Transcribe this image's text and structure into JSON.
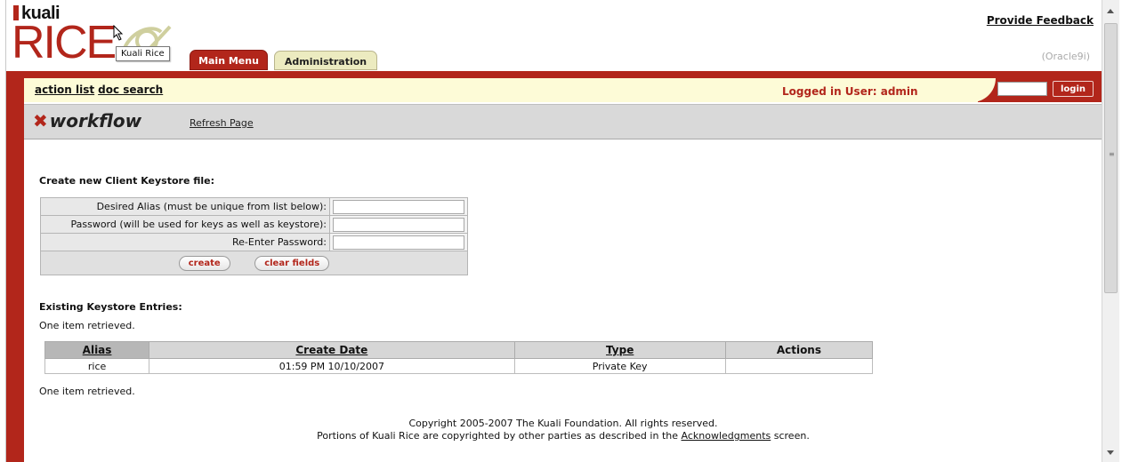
{
  "header": {
    "kuali_logo": "kuali",
    "rice_logo": "RICE",
    "tooltip": "Kuali Rice",
    "tabs": [
      {
        "label": "Main Menu",
        "active": true
      },
      {
        "label": "Administration",
        "active": false
      }
    ],
    "feedback_link": "Provide Feedback",
    "db_label": "(Oracle9i)"
  },
  "nav": {
    "action_list": "action list",
    "doc_search": "doc search",
    "logged_in": "Logged in User: admin",
    "login_button": "login"
  },
  "workflow": {
    "logo": "workflow",
    "refresh": "Refresh Page"
  },
  "create_form": {
    "heading": "Create new Client Keystore file:",
    "fields": [
      {
        "label": "Desired Alias (must be unique from list below):",
        "value": ""
      },
      {
        "label": "Password (will be used for keys as well as keystore):",
        "value": ""
      },
      {
        "label": "Re-Enter Password:",
        "value": ""
      }
    ],
    "create_button": "create",
    "clear_button": "clear fields"
  },
  "existing": {
    "heading": "Existing Keystore Entries:",
    "retrieved_top": "One item retrieved.",
    "retrieved_bottom": "One item retrieved.",
    "columns": [
      "Alias",
      "Create Date",
      "Type",
      "Actions"
    ],
    "rows": [
      {
        "alias": "rice",
        "create_date": "01:59 PM 10/10/2007",
        "type": "Private Key",
        "actions": ""
      }
    ]
  },
  "footer": {
    "line1": "Copyright 2005-2007 The Kuali Foundation. All rights reserved.",
    "line2_prefix": "Portions of Kuali Rice are copyrighted by other parties as described in the",
    "line2_link": "Acknowledgments",
    "line2_suffix": "screen."
  },
  "colors": {
    "brand_red": "#b2261b",
    "nav_yellow": "#fdfbd7",
    "tab_admin": "#ecebc0"
  }
}
